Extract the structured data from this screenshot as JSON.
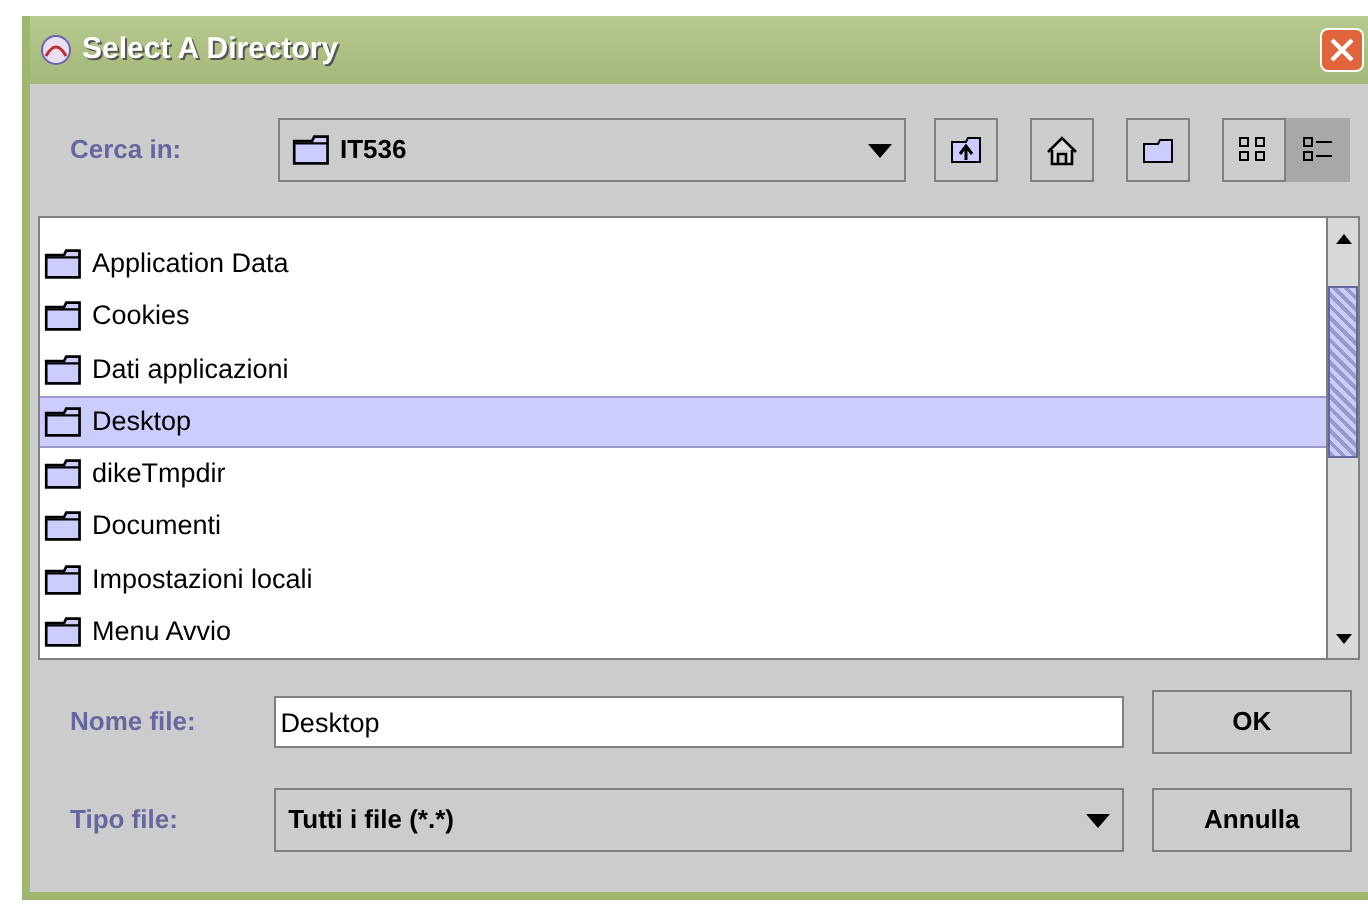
{
  "window": {
    "title": "Select A Directory"
  },
  "look_in": {
    "label": "Cerca in:",
    "value": "IT536"
  },
  "toolbar": [
    {
      "kind": "up",
      "selected": false
    },
    {
      "kind": "home",
      "selected": false
    },
    {
      "kind": "new-folder",
      "selected": false
    },
    {
      "kind": "list",
      "selected": false
    },
    {
      "kind": "details",
      "selected": true
    }
  ],
  "files": [
    {
      "name": "Application Data",
      "selected": false
    },
    {
      "name": "Cookies",
      "selected": false
    },
    {
      "name": "Dati applicazioni",
      "selected": false
    },
    {
      "name": "Desktop",
      "selected": true
    },
    {
      "name": "dikeTmpdir",
      "selected": false
    },
    {
      "name": "Documenti",
      "selected": false
    },
    {
      "name": "Impostazioni locali",
      "selected": false
    },
    {
      "name": "Menu Avvio",
      "selected": false
    }
  ],
  "file_name": {
    "label": "Nome file:",
    "value": "Desktop"
  },
  "file_type": {
    "label": "Tipo file:",
    "value": "Tutti i file (*.*)"
  },
  "buttons": [
    {
      "label": "OK"
    },
    {
      "label": "Annulla"
    }
  ]
}
